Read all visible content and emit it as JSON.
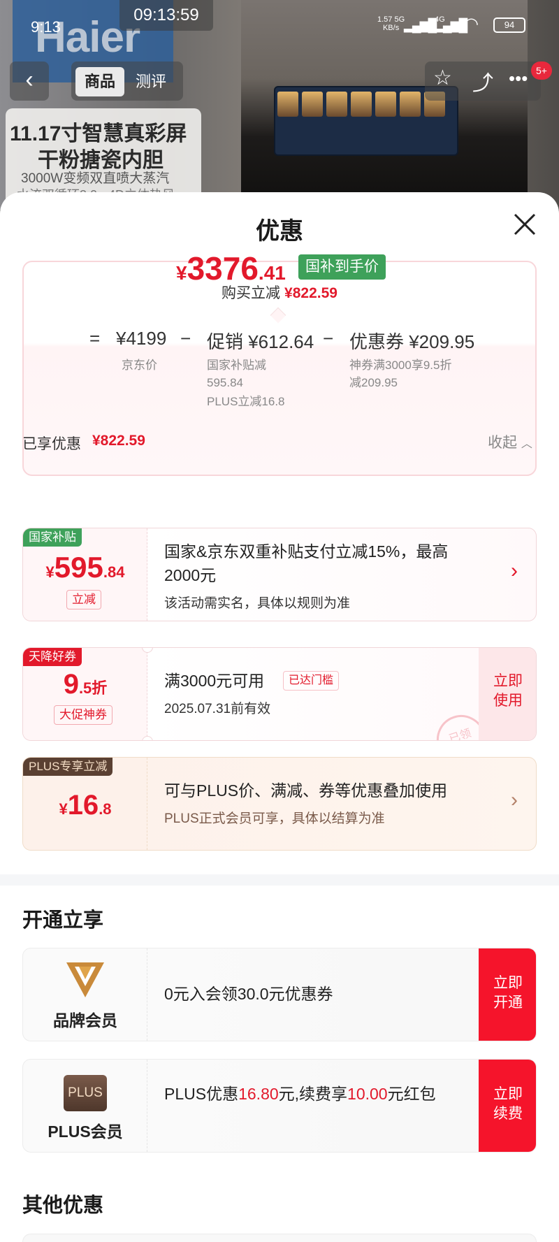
{
  "status_bar": {
    "time": "9:13",
    "clock": "09:13:59",
    "net_speed": "1.57",
    "net_unit": "KB/s",
    "net_5g": "5G",
    "net_4g": "4G",
    "battery": "94"
  },
  "background": {
    "brand": "Haier",
    "promo_line1": "11.17寸智慧真彩屏",
    "promo_line2": "干粉搪瓷内胆",
    "promo_line3": "3000W变频双直喷大蒸汽",
    "promo_line4": "水流双循环3.0 · 4D立体热风"
  },
  "navbar": {
    "back_icon": "chevron-left-icon",
    "tab_product": "商品",
    "tab_review": "测评",
    "badge": "5+"
  },
  "sheet": {
    "title": "优惠",
    "summary": {
      "price_yen": "¥",
      "price_int": "3376",
      "price_dec": ".41",
      "price_tag": "国补到手价",
      "reduce_label": "购买立减",
      "reduce_value": "¥822.59",
      "eq": "=",
      "base_price": "¥4199",
      "base_label": "京东价",
      "minus": "−",
      "promo_value": "促销 ¥612.64",
      "promo_sub1": "国家补贴减",
      "promo_sub2": "595.84",
      "promo_sub3": "PLUS立减16.8",
      "coupon_value": "优惠券 ¥209.95",
      "coupon_sub1": "神券满3000享9.5折",
      "coupon_sub2": "减209.95"
    },
    "applied": {
      "label": "已享优惠",
      "value": "¥822.59",
      "collapse": "收起"
    },
    "offers": [
      {
        "tag": "国家补贴",
        "amount_yen": "¥",
        "amount_int": "595",
        "amount_dec": ".84",
        "pill": "立减",
        "title_line1": "国家&京东双重补贴支付立减15%，最高",
        "title_line2": "2000元",
        "note": "该活动需实名，具体以规则为准"
      },
      {
        "tag": "天降好券",
        "amount_int": "9",
        "amount_dec": ".5折",
        "pill": "大促神券",
        "title": "满3000元可用",
        "reached": "已达门槛",
        "validity": "2025.07.31前有效",
        "button": "立即使用",
        "stamp": "已领"
      },
      {
        "tag": "PLUS专享立减",
        "amount_yen": "¥",
        "amount_int": "16",
        "amount_dec": ".8",
        "title": "可与PLUS价、满减、券等优惠叠加使用",
        "note": "PLUS正式会员可享，具体以结算为准"
      }
    ],
    "membership_title": "开通立享",
    "members": [
      {
        "name": "品牌会员",
        "desc": "0元入会领30.0元优惠券",
        "button": "立即开通"
      },
      {
        "name": "PLUS会员",
        "logo": "PLUS",
        "desc_a": "PLUS优惠",
        "desc_b": "16.80",
        "desc_c": "元,续费享",
        "desc_d": "10.00",
        "desc_e": "元红包",
        "button": "立即续费"
      }
    ],
    "other_title": "其他优惠"
  },
  "colors": {
    "accent_red": "#e2192b",
    "button_red": "#f5142b",
    "green_tag": "#3ea15a",
    "plus_brown": "#5a4032"
  }
}
